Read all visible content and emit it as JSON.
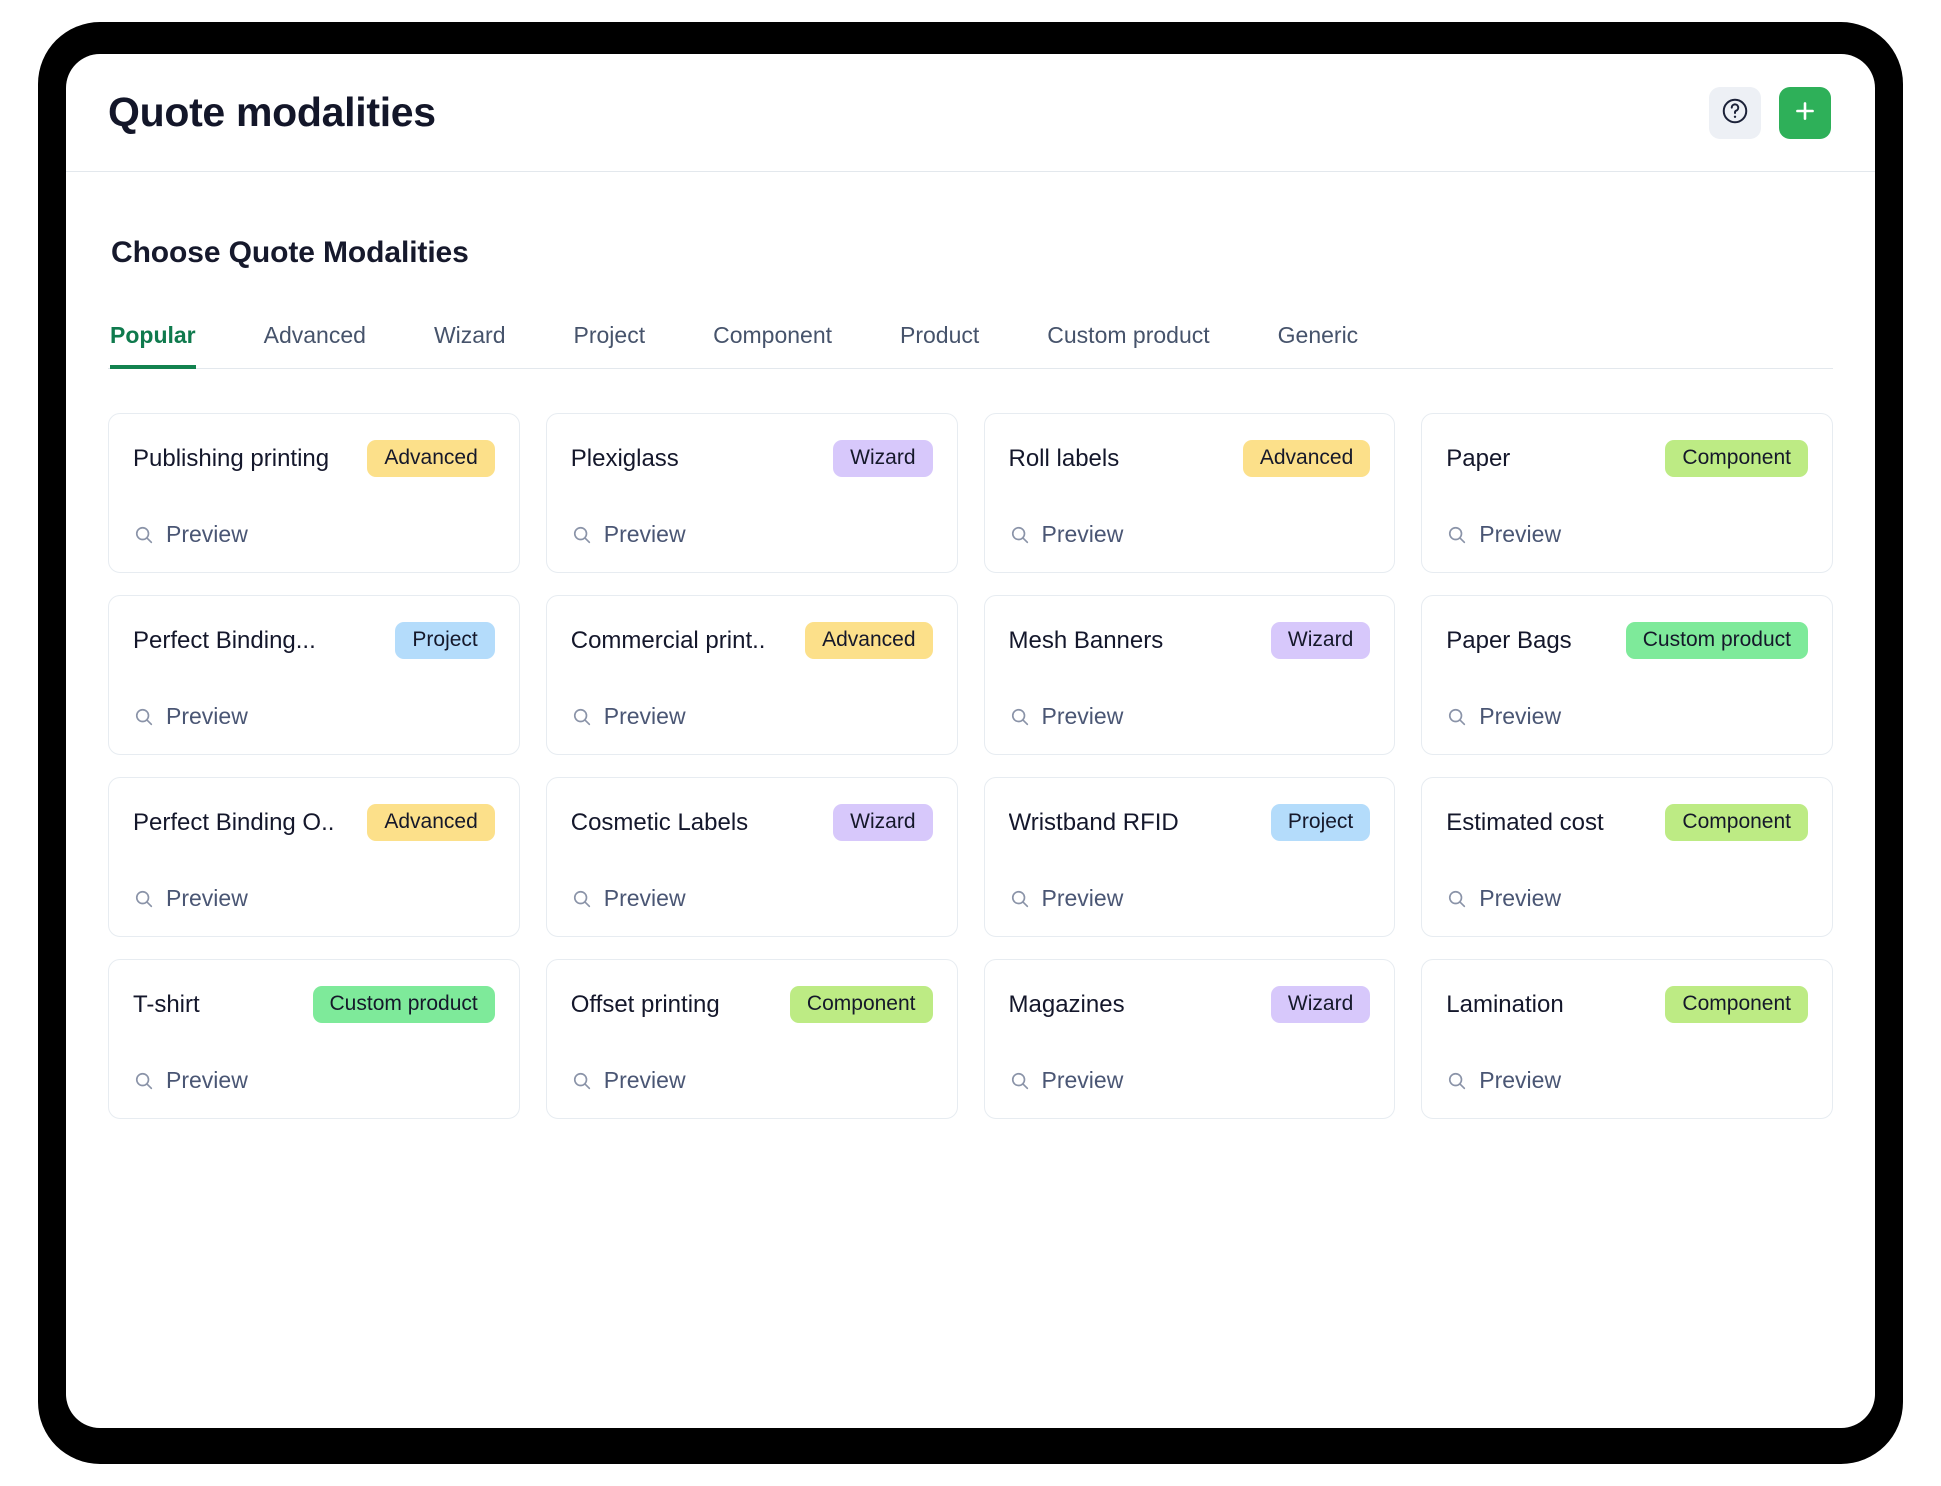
{
  "header": {
    "title": "Quote modalities",
    "help_button_label": "?",
    "add_button_label": "+"
  },
  "section": {
    "heading": "Choose Quote Modalities"
  },
  "tabs": [
    {
      "label": "Popular",
      "active": true
    },
    {
      "label": "Advanced",
      "active": false
    },
    {
      "label": "Wizard",
      "active": false
    },
    {
      "label": "Project",
      "active": false
    },
    {
      "label": "Component",
      "active": false
    },
    {
      "label": "Product",
      "active": false
    },
    {
      "label": "Custom product",
      "active": false
    },
    {
      "label": "Generic",
      "active": false
    }
  ],
  "preview_label": "Preview",
  "badge_colors": {
    "Advanced": "#fce08a",
    "Wizard": "#d7c8fb",
    "Project": "#b4dcfb",
    "Component": "#bdeb84",
    "Custom product": "#7eea9a"
  },
  "accent_colors": {
    "active_tab": "#12824f",
    "add_button": "#2eb059",
    "help_button_bg": "#edf0f5",
    "title": "#131629",
    "preview_link": "#4a5674"
  },
  "cards": [
    {
      "title": "Publishing printing",
      "badge": "Advanced",
      "badge_class": "badge-advanced"
    },
    {
      "title": "Plexiglass",
      "badge": "Wizard",
      "badge_class": "badge-wizard"
    },
    {
      "title": "Roll labels",
      "badge": "Advanced",
      "badge_class": "badge-advanced"
    },
    {
      "title": "Paper",
      "badge": "Component",
      "badge_class": "badge-component"
    },
    {
      "title": "Perfect Binding...",
      "badge": "Project",
      "badge_class": "badge-project"
    },
    {
      "title": "Commercial print..",
      "badge": "Advanced",
      "badge_class": "badge-advanced"
    },
    {
      "title": "Mesh Banners",
      "badge": "Wizard",
      "badge_class": "badge-wizard"
    },
    {
      "title": "Paper Bags",
      "badge": "Custom product",
      "badge_class": "badge-custom-product"
    },
    {
      "title": "Perfect Binding O..",
      "badge": "Advanced",
      "badge_class": "badge-advanced"
    },
    {
      "title": "Cosmetic Labels",
      "badge": "Wizard",
      "badge_class": "badge-wizard"
    },
    {
      "title": "Wristband RFID",
      "badge": "Project",
      "badge_class": "badge-project"
    },
    {
      "title": "Estimated cost",
      "badge": "Component",
      "badge_class": "badge-component"
    },
    {
      "title": "T-shirt",
      "badge": "Custom product",
      "badge_class": "badge-custom-product"
    },
    {
      "title": "Offset printing",
      "badge": "Component",
      "badge_class": "badge-component"
    },
    {
      "title": "Magazines",
      "badge": "Wizard",
      "badge_class": "badge-wizard"
    },
    {
      "title": "Lamination",
      "badge": "Component",
      "badge_class": "badge-component"
    }
  ]
}
